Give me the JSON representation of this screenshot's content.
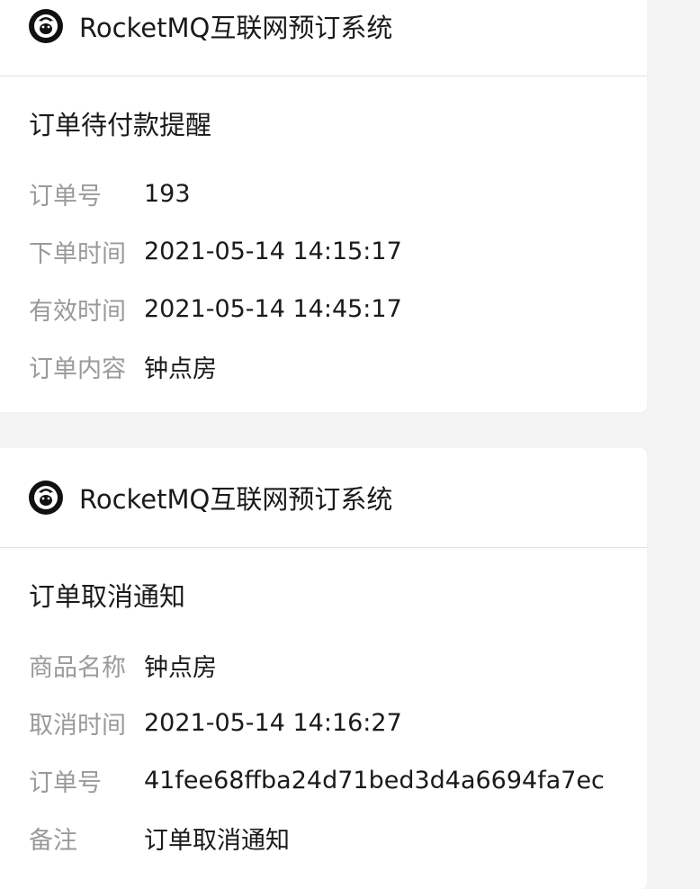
{
  "app": {
    "title": "RocketMQ互联网预订系统",
    "logo_icon": "rocketmq-logo-icon"
  },
  "card1": {
    "notice_title": "订单待付款提醒",
    "rows": [
      {
        "label": "订单号",
        "value": "193"
      },
      {
        "label": "下单时间",
        "value": "2021-05-14 14:15:17"
      },
      {
        "label": "有效时间",
        "value": "2021-05-14 14:45:17"
      },
      {
        "label": "订单内容",
        "value": "钟点房"
      }
    ]
  },
  "card2": {
    "notice_title": "订单取消通知",
    "rows": [
      {
        "label": "商品名称",
        "value": "钟点房"
      },
      {
        "label": "取消时间",
        "value": "2021-05-14 14:16:27"
      },
      {
        "label": "订单号",
        "value": "41fee68ffba24d71bed3d4a6694fa7ec"
      },
      {
        "label": "备注",
        "value": "订单取消通知"
      }
    ]
  },
  "colors": {
    "background": "#f3f3f3",
    "card": "#ffffff",
    "label": "#9a9a9a",
    "text": "#1a1a1a",
    "divider": "#e2e2e2"
  }
}
